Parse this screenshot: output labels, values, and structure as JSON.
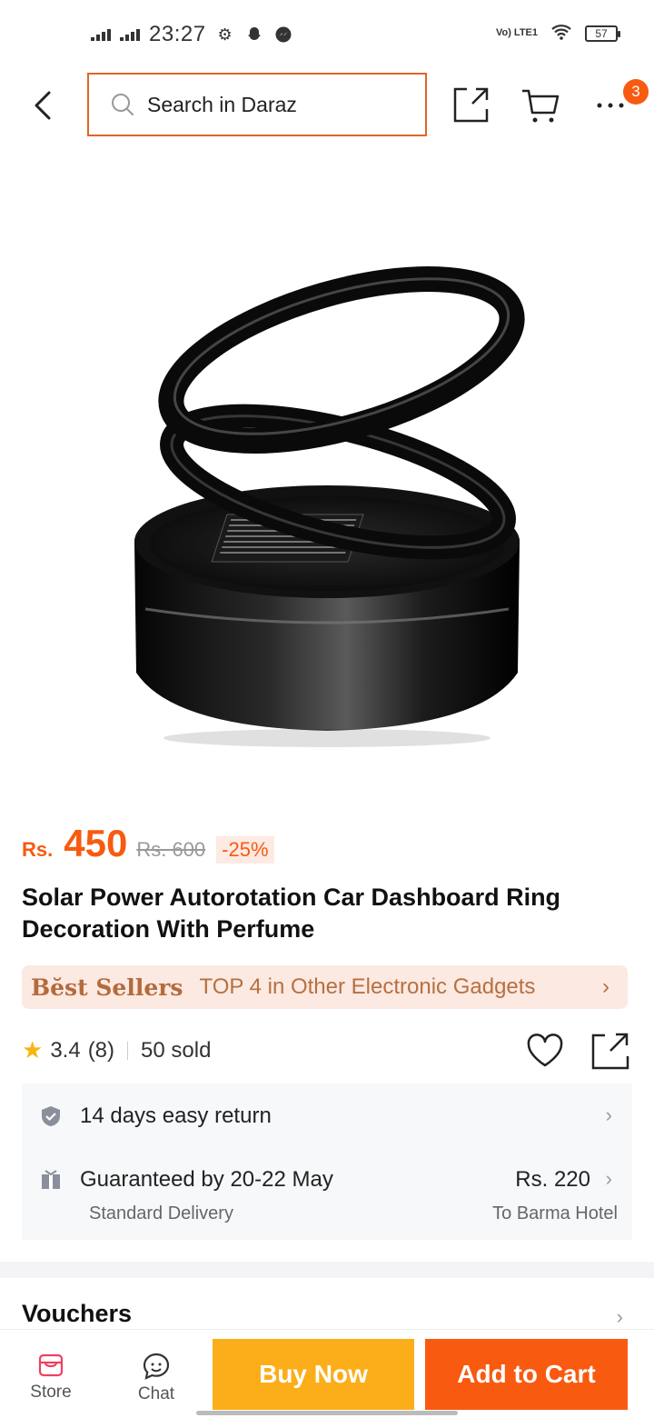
{
  "status_bar": {
    "time": "23:27",
    "volte": "Vo) LTE1",
    "battery": "57"
  },
  "header": {
    "search_placeholder": "Search in Daraz",
    "cart_badge": "3"
  },
  "product": {
    "currency": "Rs.",
    "price": "450",
    "old_price": "Rs. 600",
    "discount": "-25%",
    "title": "Solar Power Autorotation Car Dashboard Ring Decoration With Perfume",
    "best_sellers_logo": "Bĕst Sellers",
    "best_sellers_text": "TOP 4 in Other Electronic Gadgets",
    "rating": "3.4",
    "rating_count": "(8)",
    "sold": "50 sold"
  },
  "service": {
    "return_text": "14 days easy return",
    "delivery_text": "Guaranteed by 20-22 May",
    "delivery_price": "Rs. 220",
    "delivery_type": "Standard Delivery",
    "delivery_location": "To Barma Hotel"
  },
  "vouchers": {
    "label": "Vouchers"
  },
  "bottom_bar": {
    "store_label": "Store",
    "chat_label": "Chat",
    "buy_now_label": "Buy Now",
    "add_to_cart_label": "Add to Cart"
  },
  "colors": {
    "accent": "#f85a10",
    "buy_now": "#fbae1a",
    "search_border": "#e2642a"
  }
}
